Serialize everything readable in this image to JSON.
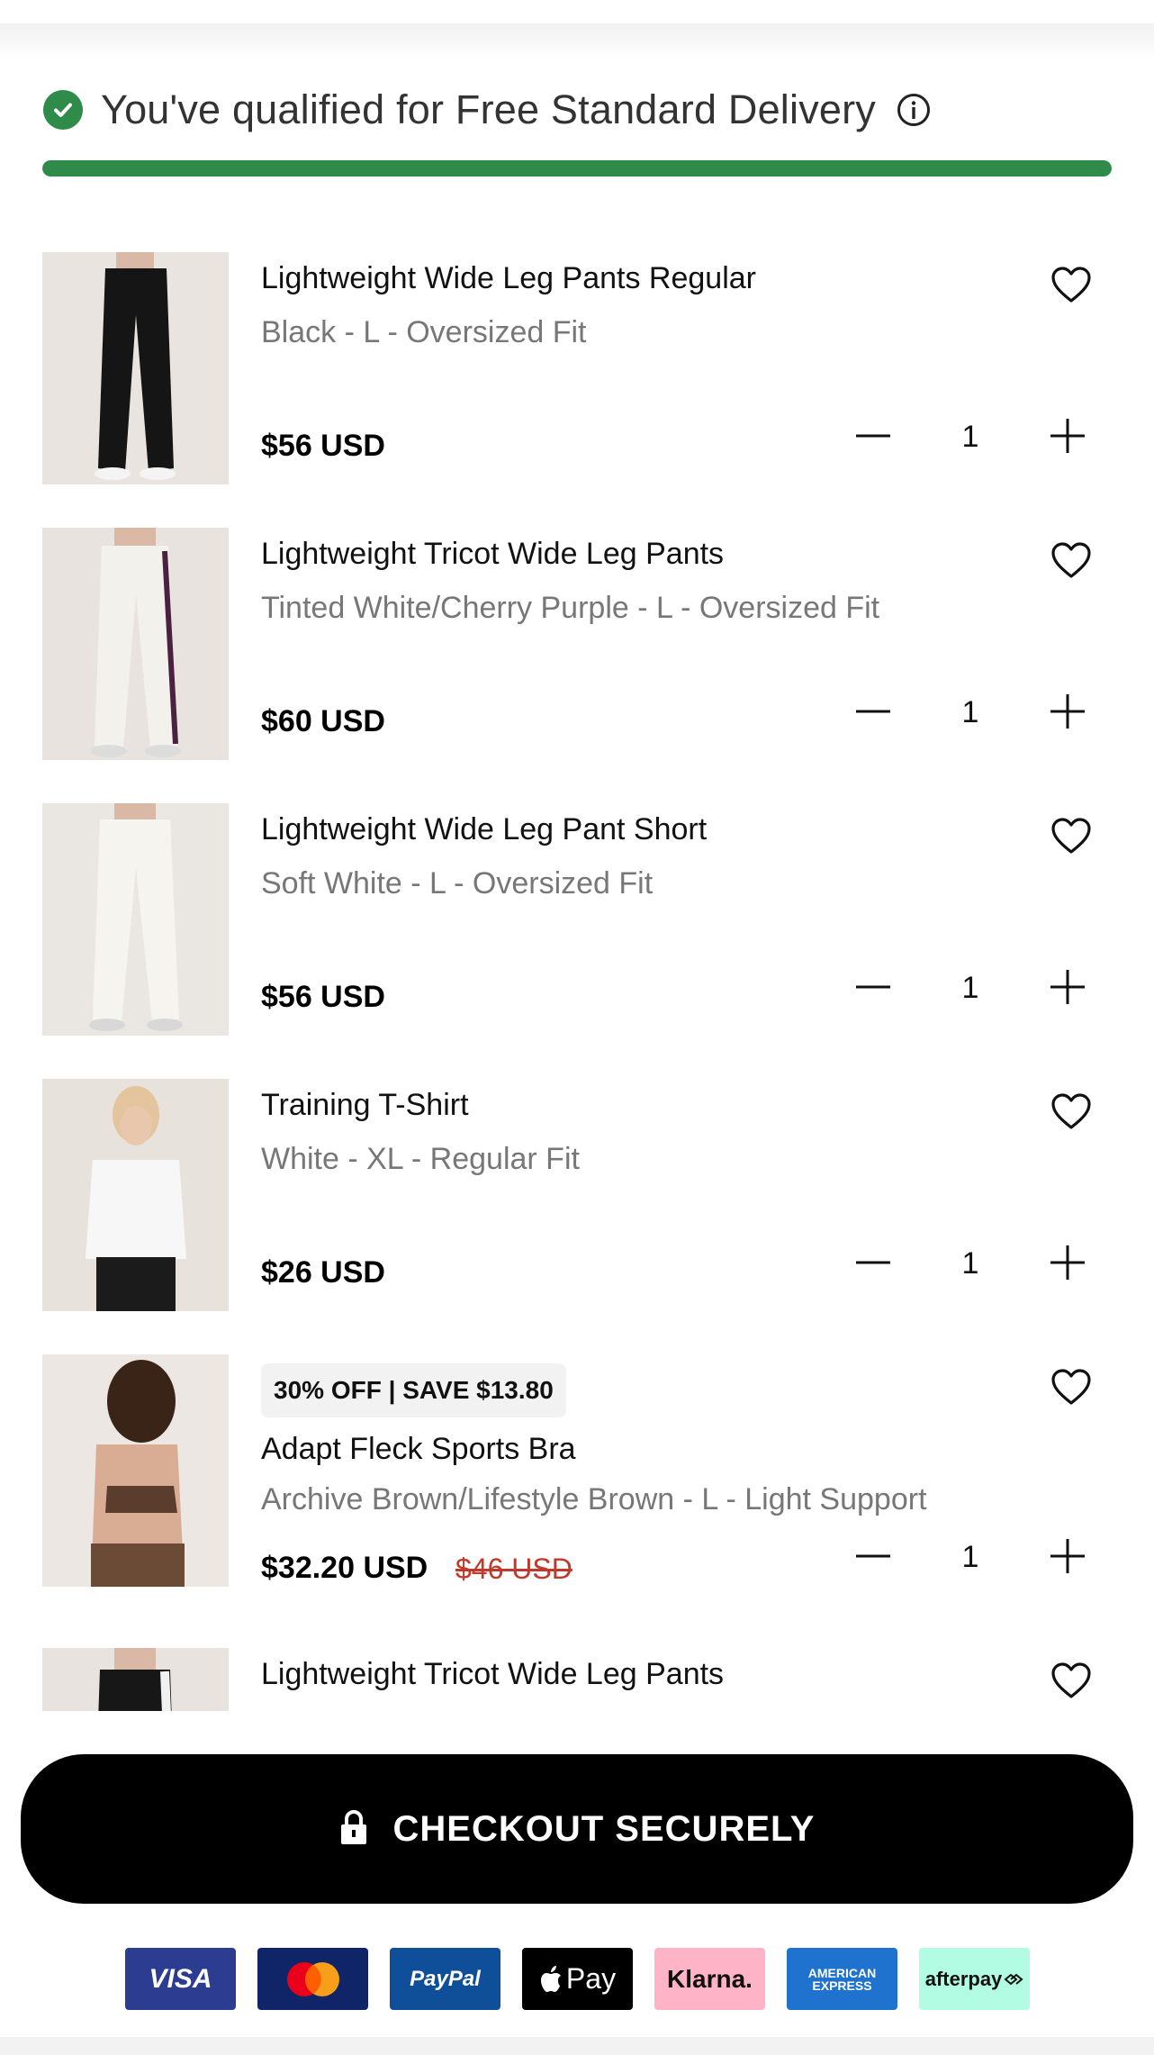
{
  "banner": {
    "text": "You've qualified for Free Standard Delivery",
    "progress_fraction": 1.0,
    "accent_color": "#2e8b4a",
    "check_icon": "check-circle-icon",
    "info_icon": "info-icon"
  },
  "items": [
    {
      "title": "Lightweight Wide Leg Pants Regular",
      "variant": "Black - L - Oversized Fit",
      "price": "$56 USD",
      "quantity": "1",
      "badge": "",
      "old_price": "",
      "image": "black wide leg pants"
    },
    {
      "title": "Lightweight Tricot Wide Leg Pants",
      "variant": "Tinted White/Cherry Purple - L - Oversized Fit",
      "price": "$60 USD",
      "quantity": "1",
      "badge": "",
      "old_price": "",
      "image": "white tricot pants with purple stripe"
    },
    {
      "title": "Lightweight Wide Leg Pant Short",
      "variant": "Soft White - L - Oversized Fit",
      "price": "$56 USD",
      "quantity": "1",
      "badge": "",
      "old_price": "",
      "image": "soft white wide leg pants"
    },
    {
      "title": "Training T-Shirt",
      "variant": "White - XL - Regular Fit",
      "price": "$26 USD",
      "quantity": "1",
      "badge": "",
      "old_price": "",
      "image": "white training t-shirt"
    },
    {
      "title": "Adapt Fleck Sports Bra",
      "variant": "Archive Brown/Lifestyle Brown - L - Light Support",
      "price": "$32.20 USD",
      "quantity": "1",
      "badge": "30% OFF | SAVE $13.80",
      "old_price": "$46 USD",
      "image": "brown fleck sports bra"
    },
    {
      "title": "Lightweight Tricot Wide Leg Pants",
      "variant": "",
      "price": "",
      "quantity": "",
      "badge": "",
      "old_price": "",
      "image": "black tricot pants with white stripe"
    }
  ],
  "checkout": {
    "label": "CHECKOUT SECURELY",
    "icon": "lock-icon"
  },
  "payments": {
    "visa": "VISA",
    "paypal": "PayPal",
    "apple_pay": "Pay",
    "klarna": "Klarna.",
    "amex_line1": "AMERICAN",
    "amex_line2": "EXPRESS",
    "afterpay": "afterpay"
  },
  "icons": {
    "wishlist": "heart-icon",
    "decrease": "minus-icon",
    "increase": "plus-icon"
  }
}
